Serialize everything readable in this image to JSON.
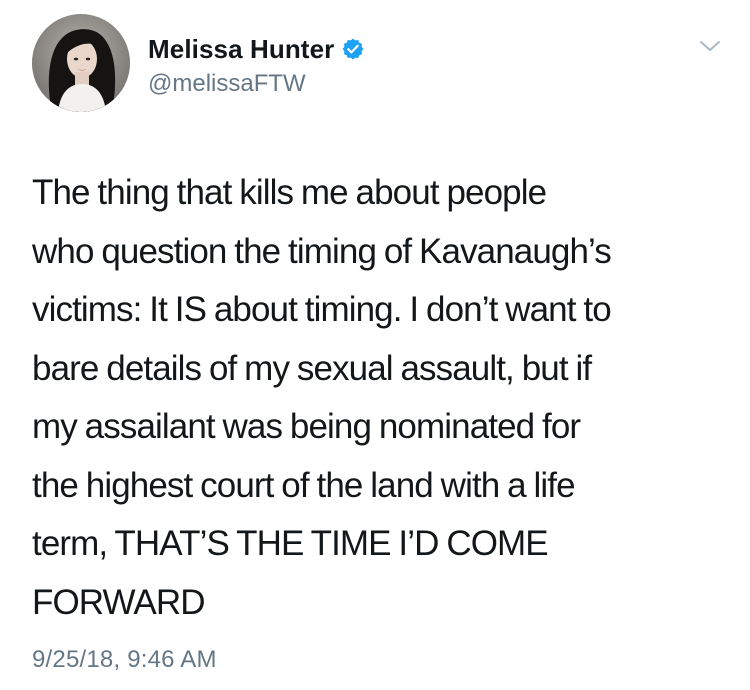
{
  "author": {
    "display_name": "Melissa Hunter",
    "handle": "@melissaFTW",
    "verified": true,
    "avatar_icon": "profile-photo",
    "verified_icon": "verified-badge-icon",
    "verified_color": "#1da1f2"
  },
  "menu": {
    "icon": "chevron-down-icon"
  },
  "tweet": {
    "text_lines": [
      "The thing that kills me about people",
      "who question the timing of Kavanaugh’s",
      "victims: It IS about timing. I don’t want to",
      "bare details of my sexual assault, but if",
      "my assailant was being nominated for",
      "the highest court of the land with a life",
      "term, THAT’S THE TIME I’D COME",
      "FORWARD"
    ],
    "timestamp": "9/25/18, 9:46 AM"
  },
  "colors": {
    "text": "#14171a",
    "secondary": "#657786",
    "background": "#ffffff",
    "caret": "#aab8c2"
  }
}
